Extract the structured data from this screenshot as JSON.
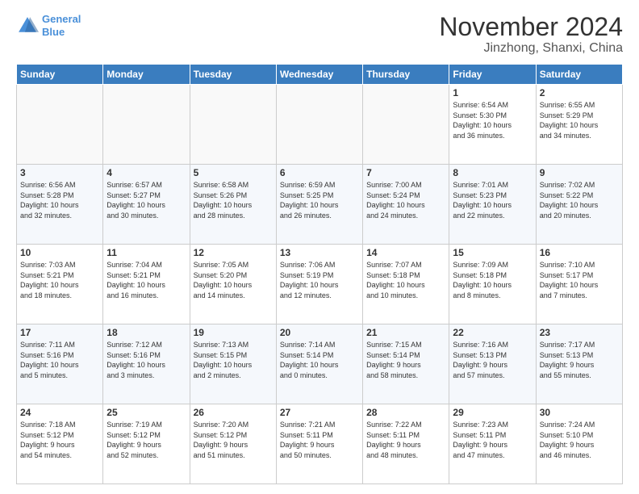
{
  "header": {
    "logo_line1": "General",
    "logo_line2": "Blue",
    "month": "November 2024",
    "location": "Jinzhong, Shanxi, China"
  },
  "weekdays": [
    "Sunday",
    "Monday",
    "Tuesday",
    "Wednesday",
    "Thursday",
    "Friday",
    "Saturday"
  ],
  "weeks": [
    [
      {
        "day": "",
        "info": ""
      },
      {
        "day": "",
        "info": ""
      },
      {
        "day": "",
        "info": ""
      },
      {
        "day": "",
        "info": ""
      },
      {
        "day": "",
        "info": ""
      },
      {
        "day": "1",
        "info": "Sunrise: 6:54 AM\nSunset: 5:30 PM\nDaylight: 10 hours\nand 36 minutes."
      },
      {
        "day": "2",
        "info": "Sunrise: 6:55 AM\nSunset: 5:29 PM\nDaylight: 10 hours\nand 34 minutes."
      }
    ],
    [
      {
        "day": "3",
        "info": "Sunrise: 6:56 AM\nSunset: 5:28 PM\nDaylight: 10 hours\nand 32 minutes."
      },
      {
        "day": "4",
        "info": "Sunrise: 6:57 AM\nSunset: 5:27 PM\nDaylight: 10 hours\nand 30 minutes."
      },
      {
        "day": "5",
        "info": "Sunrise: 6:58 AM\nSunset: 5:26 PM\nDaylight: 10 hours\nand 28 minutes."
      },
      {
        "day": "6",
        "info": "Sunrise: 6:59 AM\nSunset: 5:25 PM\nDaylight: 10 hours\nand 26 minutes."
      },
      {
        "day": "7",
        "info": "Sunrise: 7:00 AM\nSunset: 5:24 PM\nDaylight: 10 hours\nand 24 minutes."
      },
      {
        "day": "8",
        "info": "Sunrise: 7:01 AM\nSunset: 5:23 PM\nDaylight: 10 hours\nand 22 minutes."
      },
      {
        "day": "9",
        "info": "Sunrise: 7:02 AM\nSunset: 5:22 PM\nDaylight: 10 hours\nand 20 minutes."
      }
    ],
    [
      {
        "day": "10",
        "info": "Sunrise: 7:03 AM\nSunset: 5:21 PM\nDaylight: 10 hours\nand 18 minutes."
      },
      {
        "day": "11",
        "info": "Sunrise: 7:04 AM\nSunset: 5:21 PM\nDaylight: 10 hours\nand 16 minutes."
      },
      {
        "day": "12",
        "info": "Sunrise: 7:05 AM\nSunset: 5:20 PM\nDaylight: 10 hours\nand 14 minutes."
      },
      {
        "day": "13",
        "info": "Sunrise: 7:06 AM\nSunset: 5:19 PM\nDaylight: 10 hours\nand 12 minutes."
      },
      {
        "day": "14",
        "info": "Sunrise: 7:07 AM\nSunset: 5:18 PM\nDaylight: 10 hours\nand 10 minutes."
      },
      {
        "day": "15",
        "info": "Sunrise: 7:09 AM\nSunset: 5:18 PM\nDaylight: 10 hours\nand 8 minutes."
      },
      {
        "day": "16",
        "info": "Sunrise: 7:10 AM\nSunset: 5:17 PM\nDaylight: 10 hours\nand 7 minutes."
      }
    ],
    [
      {
        "day": "17",
        "info": "Sunrise: 7:11 AM\nSunset: 5:16 PM\nDaylight: 10 hours\nand 5 minutes."
      },
      {
        "day": "18",
        "info": "Sunrise: 7:12 AM\nSunset: 5:16 PM\nDaylight: 10 hours\nand 3 minutes."
      },
      {
        "day": "19",
        "info": "Sunrise: 7:13 AM\nSunset: 5:15 PM\nDaylight: 10 hours\nand 2 minutes."
      },
      {
        "day": "20",
        "info": "Sunrise: 7:14 AM\nSunset: 5:14 PM\nDaylight: 10 hours\nand 0 minutes."
      },
      {
        "day": "21",
        "info": "Sunrise: 7:15 AM\nSunset: 5:14 PM\nDaylight: 9 hours\nand 58 minutes."
      },
      {
        "day": "22",
        "info": "Sunrise: 7:16 AM\nSunset: 5:13 PM\nDaylight: 9 hours\nand 57 minutes."
      },
      {
        "day": "23",
        "info": "Sunrise: 7:17 AM\nSunset: 5:13 PM\nDaylight: 9 hours\nand 55 minutes."
      }
    ],
    [
      {
        "day": "24",
        "info": "Sunrise: 7:18 AM\nSunset: 5:12 PM\nDaylight: 9 hours\nand 54 minutes."
      },
      {
        "day": "25",
        "info": "Sunrise: 7:19 AM\nSunset: 5:12 PM\nDaylight: 9 hours\nand 52 minutes."
      },
      {
        "day": "26",
        "info": "Sunrise: 7:20 AM\nSunset: 5:12 PM\nDaylight: 9 hours\nand 51 minutes."
      },
      {
        "day": "27",
        "info": "Sunrise: 7:21 AM\nSunset: 5:11 PM\nDaylight: 9 hours\nand 50 minutes."
      },
      {
        "day": "28",
        "info": "Sunrise: 7:22 AM\nSunset: 5:11 PM\nDaylight: 9 hours\nand 48 minutes."
      },
      {
        "day": "29",
        "info": "Sunrise: 7:23 AM\nSunset: 5:11 PM\nDaylight: 9 hours\nand 47 minutes."
      },
      {
        "day": "30",
        "info": "Sunrise: 7:24 AM\nSunset: 5:10 PM\nDaylight: 9 hours\nand 46 minutes."
      }
    ]
  ]
}
